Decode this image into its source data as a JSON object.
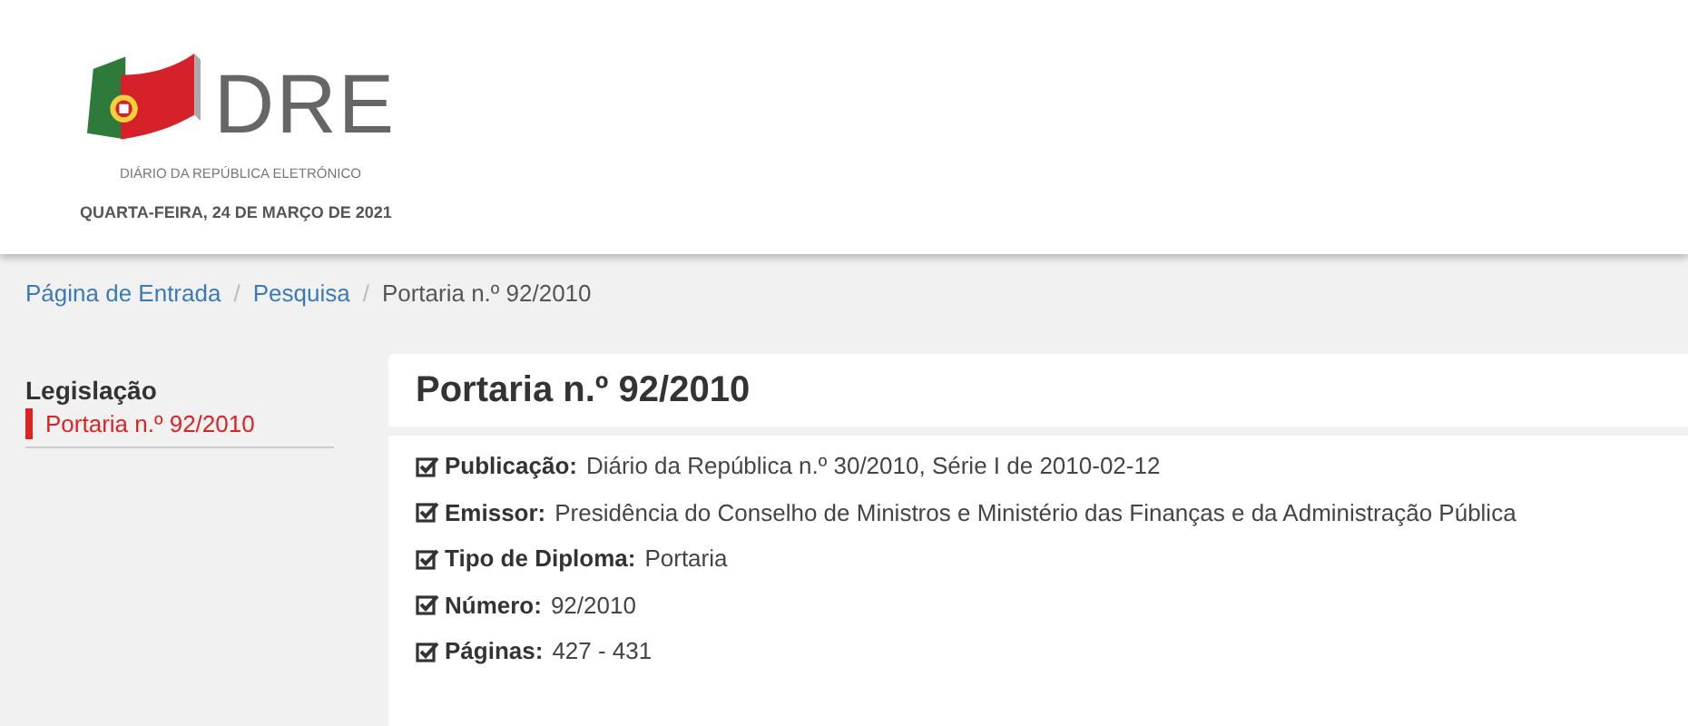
{
  "header": {
    "logo": {
      "wordmark": "DRE",
      "subtitle": "DIÁRIO DA REPÚBLICA ELETRÓNICO"
    },
    "date": "QUARTA-FEIRA, 24 DE MARÇO DE 2021"
  },
  "breadcrumb_separator": "/",
  "breadcrumb": [
    {
      "label": "Página de Entrada",
      "link": true
    },
    {
      "label": "Pesquisa",
      "link": true
    },
    {
      "label": "Portaria n.º 92/2010",
      "link": false
    }
  ],
  "sidebar": {
    "heading": "Legislação",
    "items": [
      {
        "label": "Portaria n.º 92/2010",
        "selected": true
      }
    ]
  },
  "document": {
    "title": "Portaria n.º 92/2010",
    "fields": [
      {
        "label": "Publicação:",
        "value": "Diário da República n.º 30/2010, Série I de 2010-02-12"
      },
      {
        "label": "Emissor:",
        "value": "Presidência do Conselho de Ministros e Ministério das Finanças e da Administração Pública"
      },
      {
        "label": "Tipo de Diploma:",
        "value": "Portaria"
      },
      {
        "label": "Número:",
        "value": "92/2010"
      },
      {
        "label": "Páginas:",
        "value": "427 - 431"
      }
    ]
  }
}
